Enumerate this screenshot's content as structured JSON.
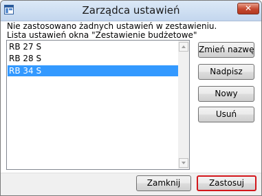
{
  "window": {
    "title": "Zarządca ustawień",
    "close_label": "✕"
  },
  "info": {
    "no_settings_text": "Nie zastosowano żadnych ustawień w zestawieniu.",
    "list_caption": "Lista ustawień okna \"Zestawienie budżetowe\""
  },
  "settings_list": {
    "items": [
      {
        "label": "RB 27 S",
        "selected": false
      },
      {
        "label": "RB 28 S",
        "selected": false
      },
      {
        "label": "RB 34 S",
        "selected": true
      }
    ]
  },
  "side_buttons": {
    "rename": "Zmień nazwę",
    "overwrite": "Nadpisz",
    "new": "Nowy",
    "delete": "Usuń"
  },
  "bottom_buttons": {
    "close": "Zamknij",
    "apply": "Zastosuj"
  },
  "colors": {
    "selection": "#3399ff",
    "focus_border": "#d3161b"
  },
  "icons": {
    "app": "window-layout-icon",
    "close": "close-icon",
    "scroll_up": "scroll-up-arrow-icon",
    "scroll_down": "scroll-down-arrow-icon"
  }
}
